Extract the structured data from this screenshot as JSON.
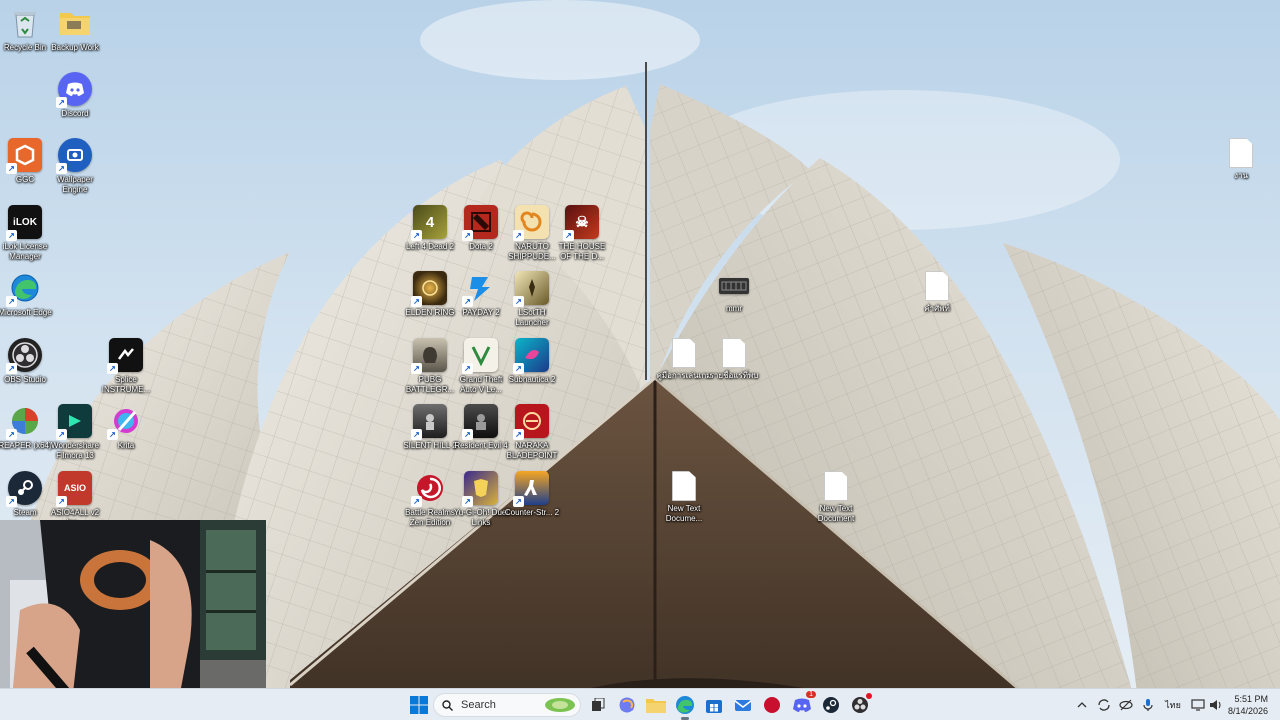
{
  "desktop": {
    "icons": [
      {
        "id": "recycle-bin",
        "label": "Recycle Bin"
      },
      {
        "id": "backup-folder",
        "label": "Backup Work"
      },
      {
        "id": "discord",
        "label": "Discord"
      },
      {
        "id": "ggc",
        "label": "GGC"
      },
      {
        "id": "wallpaper-engine",
        "label": "Wallpaper Engine"
      },
      {
        "id": "ilok",
        "label": "iLok License Manager"
      },
      {
        "id": "edge",
        "label": "Microsoft Edge"
      },
      {
        "id": "obs",
        "label": "OBS Studio"
      },
      {
        "id": "splice",
        "label": "Splice INSTRUME..."
      },
      {
        "id": "reaper",
        "label": "REAPER (x64)"
      },
      {
        "id": "filmora",
        "label": "Wondershare Filmora 13"
      },
      {
        "id": "krita",
        "label": "Krita"
      },
      {
        "id": "steam",
        "label": "Steam"
      },
      {
        "id": "asio4all",
        "label": "ASIO4ALL v2 Ins..."
      },
      {
        "id": "l4d2",
        "label": "Left 4 Dead 2"
      },
      {
        "id": "dota2",
        "label": "Dota 2"
      },
      {
        "id": "naruto",
        "label": "NARUTO SHIPPUDE..."
      },
      {
        "id": "house-dead",
        "label": "THE HOUSE OF THE D..."
      },
      {
        "id": "elden",
        "label": "ELDEN RING"
      },
      {
        "id": "payday",
        "label": "PAYDAY 2"
      },
      {
        "id": "lotr",
        "label": "LSotTH Launcher"
      },
      {
        "id": "pubg",
        "label": "PUBG BATTLEGR..."
      },
      {
        "id": "gta",
        "label": "Grand Theft Auto V Le..."
      },
      {
        "id": "subnautica",
        "label": "Subnautica 2"
      },
      {
        "id": "silent-hill",
        "label": "SILENT HILL 2"
      },
      {
        "id": "resident-evil",
        "label": "Resident Evil 4"
      },
      {
        "id": "naraka",
        "label": "NARAKA BLADEPOINT"
      },
      {
        "id": "battle-realms",
        "label": "Battle Realms Zen Edition"
      },
      {
        "id": "yugioh",
        "label": "Yu-Gi-Oh! Duel Links"
      },
      {
        "id": "cs2",
        "label": "Counter-Str... 2"
      },
      {
        "id": "mmr",
        "label": "mmr"
      },
      {
        "id": "file-thai-1",
        "label": "คู่มือการเล่นเกม"
      },
      {
        "id": "file-thai-2",
        "label": "รายชื่อแร่ที่พบ"
      },
      {
        "id": "file-thai-3",
        "label": "คำศัพท์"
      },
      {
        "id": "file-topright",
        "label": "งาน"
      },
      {
        "id": "text-doc-1",
        "label": "New Text Docume..."
      },
      {
        "id": "text-doc-2",
        "label": "New Text Document"
      }
    ]
  },
  "taskbar": {
    "search_placeholder": "Search",
    "language": "ไทย",
    "time": "5:51 PM",
    "date": "8/14/2026",
    "discord_badge": "1"
  },
  "colors": {
    "taskbar_bg": "#e6ecf3",
    "accent": "#0a64c8",
    "sky": "#cfe0ef",
    "marble": "#e6e2d8"
  }
}
